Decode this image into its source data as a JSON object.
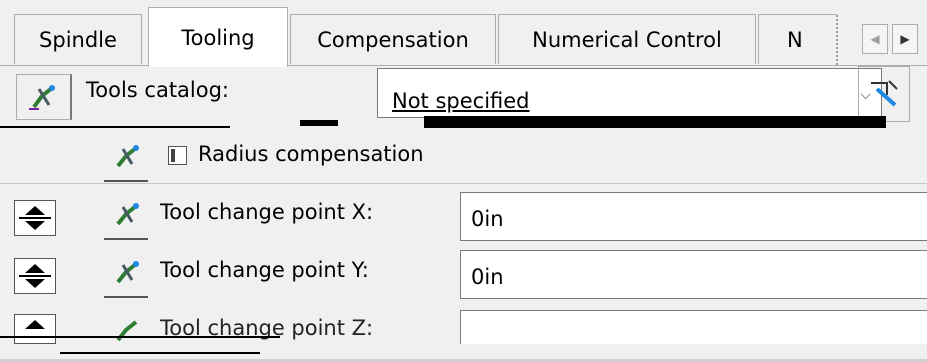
{
  "tabs": [
    {
      "label": "Spindle",
      "active": false
    },
    {
      "label": "Tooling",
      "active": true
    },
    {
      "label": "Compensation",
      "active": false
    },
    {
      "label": "Numerical Control",
      "active": false
    },
    {
      "label": "N",
      "active": false
    }
  ],
  "tab_scroll": {
    "left_glyph": "◀",
    "right_glyph": "▶"
  },
  "tools_catalog": {
    "label": "Tools catalog:",
    "value": "Not specified",
    "dropdown_glyph": "⌵"
  },
  "radius_compensation": {
    "label": "Radius compensation",
    "checked": false
  },
  "tool_change_x": {
    "label": "Tool change point X:",
    "value": "0in"
  },
  "tool_change_y": {
    "label": "Tool change point Y:",
    "value": "0in"
  },
  "tool_change_z": {
    "label": "Tool change point Z:",
    "value": ""
  },
  "colors": {
    "background": "#f0f0f0",
    "active_tab": "#ffffff",
    "border": "#adadad",
    "field": "#ffffff"
  },
  "icons": [
    "tool-icon",
    "spinner-icon",
    "pick-tool-icon",
    "chevron-down-icon"
  ]
}
